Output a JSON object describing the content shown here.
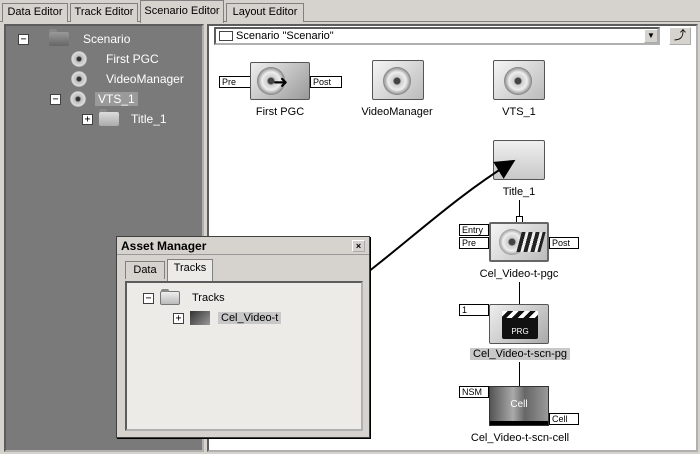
{
  "tabs": [
    {
      "label": "Data Editor"
    },
    {
      "label": "Track Editor"
    },
    {
      "label": "Scenario Editor"
    },
    {
      "label": "Layout Editor"
    }
  ],
  "tree": {
    "root": "Scenario",
    "items": [
      {
        "label": "First PGC"
      },
      {
        "label": "VideoManager"
      },
      {
        "label": "VTS_1"
      },
      {
        "label": "Title_1"
      }
    ],
    "expander_minus": "−",
    "expander_plus": "+"
  },
  "scenario": {
    "path_value": "Scenario \"Scenario\"",
    "combo_arrow": "▼",
    "up_button": "⤴"
  },
  "nodes": {
    "first_pgc": {
      "label": "First PGC",
      "port_pre": "Pre",
      "port_post": "Post"
    },
    "video_manager": {
      "label": "VideoManager"
    },
    "vts": {
      "label": "VTS_1"
    },
    "title": {
      "label": "Title_1"
    },
    "pgc": {
      "label": "Cel_Video-t-pgc",
      "port_entry": "Entry",
      "port_pre": "Pre",
      "port_post": "Post"
    },
    "pg": {
      "label": "Cel_Video-t-scn-pg",
      "port_num": "1",
      "badge": "PRG"
    },
    "cell": {
      "label": "Cel_Video-t-scn-cell",
      "port_nsm": "NSM",
      "port_cell": "Cell",
      "thumb_text": "Cell"
    }
  },
  "asset_manager": {
    "title": "Asset Manager",
    "close": "×",
    "tabs": [
      {
        "label": "Data"
      },
      {
        "label": "Tracks"
      }
    ],
    "tree_root": "Tracks",
    "tree_item": "Cel_Video-t"
  }
}
